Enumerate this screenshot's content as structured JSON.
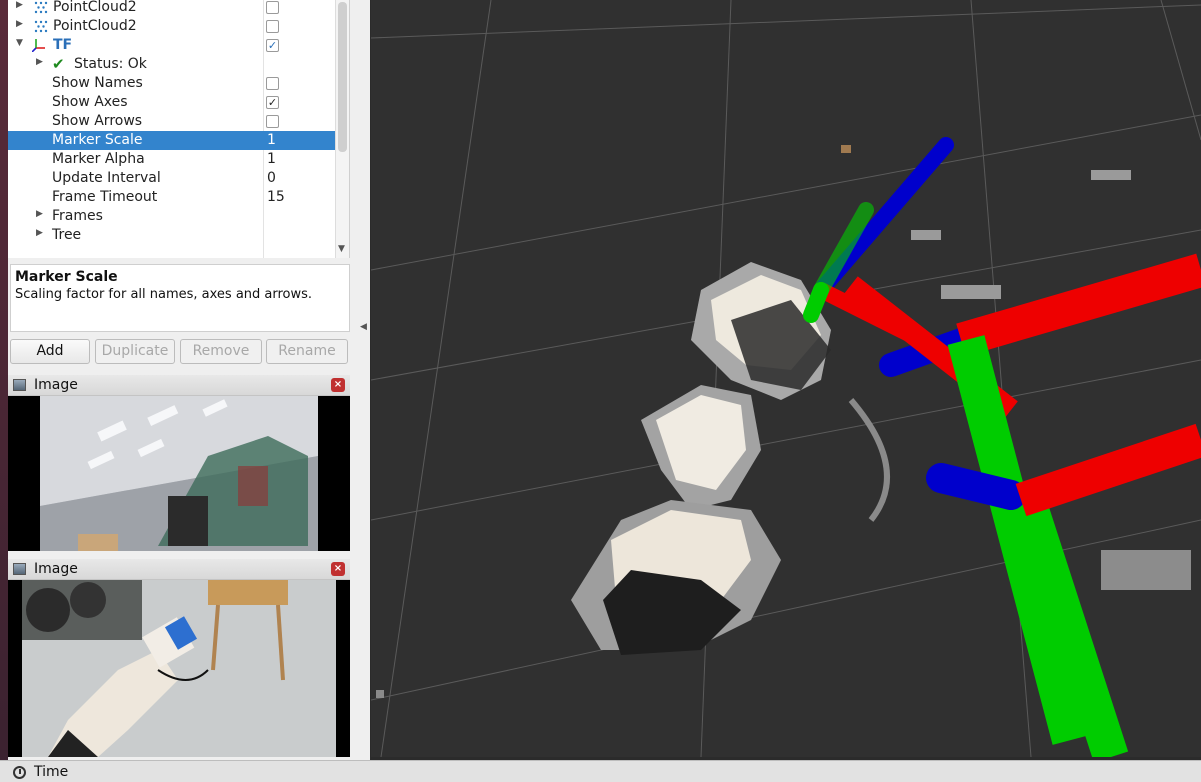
{
  "tree": {
    "rows": [
      {
        "label": "PointCloud2",
        "checked": ""
      },
      {
        "label": "PointCloud2",
        "checked": ""
      },
      {
        "label": "TF",
        "checked": "✓"
      },
      {
        "label": "Status: Ok"
      },
      {
        "label": "Show Names",
        "checked": ""
      },
      {
        "label": "Show Axes",
        "checked": "✓"
      },
      {
        "label": "Show Arrows",
        "checked": ""
      },
      {
        "label": "Marker Scale",
        "value": "1"
      },
      {
        "label": "Marker Alpha",
        "value": "1"
      },
      {
        "label": "Update Interval",
        "value": "0"
      },
      {
        "label": "Frame Timeout",
        "value": "15"
      },
      {
        "label": "Frames"
      },
      {
        "label": "Tree"
      }
    ]
  },
  "description": {
    "title": "Marker Scale",
    "text": "Scaling factor for all names, axes and arrows."
  },
  "buttons": {
    "add": "Add",
    "duplicate": "Duplicate",
    "remove": "Remove",
    "rename": "Rename"
  },
  "image_panels": [
    {
      "title": "Image"
    },
    {
      "title": "Image"
    }
  ],
  "time_bar": {
    "label": "Time"
  },
  "colors": {
    "selection": "#3384cd",
    "viewport_bg": "#303030",
    "axis_x": "#ff0000",
    "axis_y": "#00dd00",
    "axis_z": "#0000cc"
  }
}
